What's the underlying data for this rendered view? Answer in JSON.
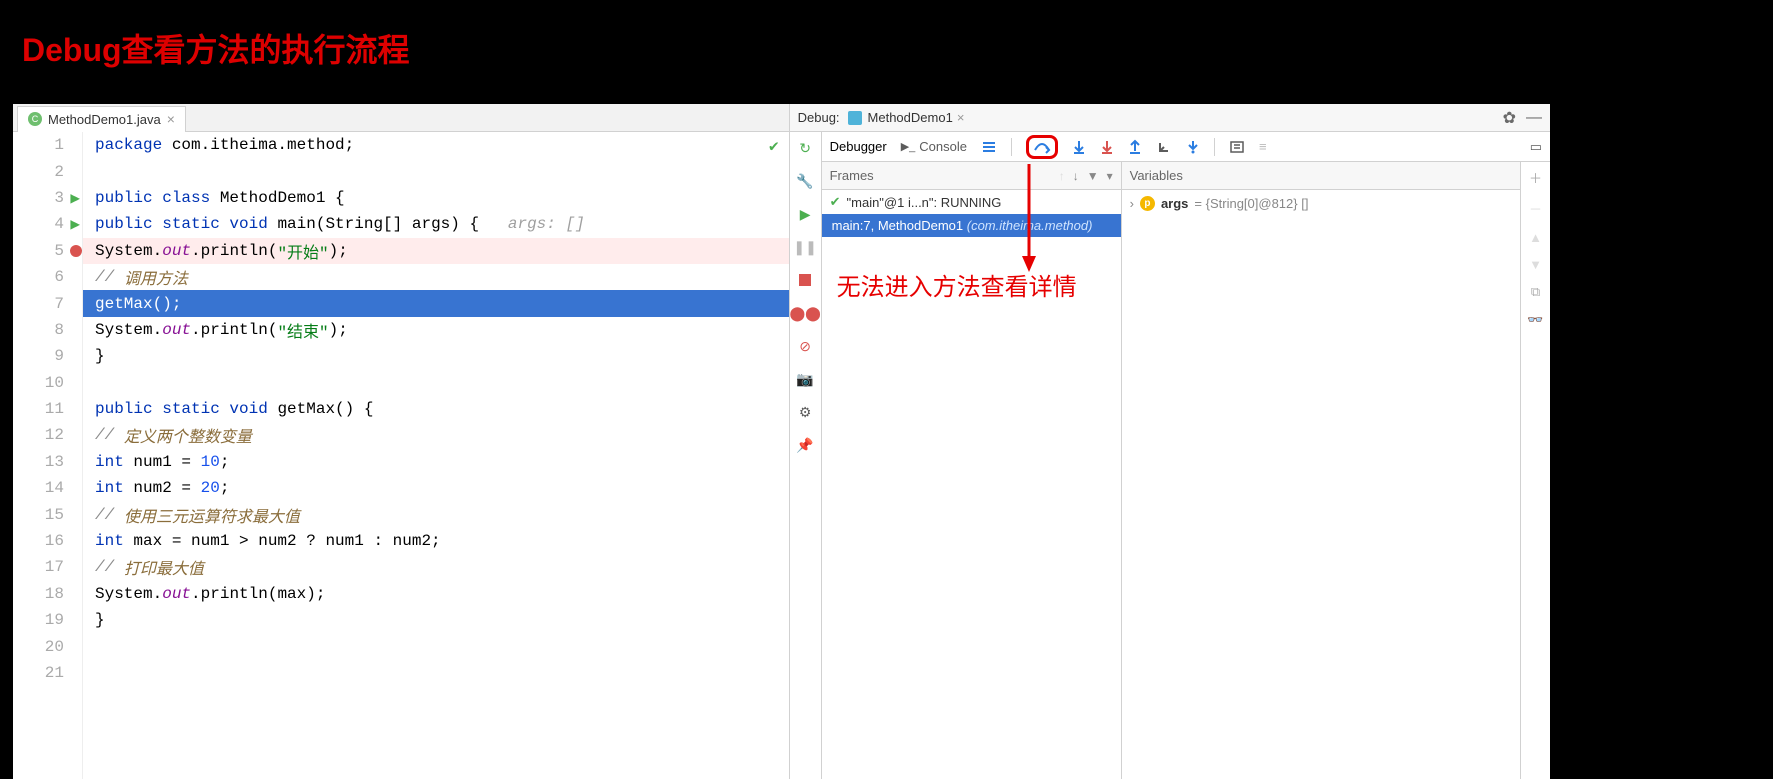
{
  "overlay_title": "Debug查看方法的执行流程",
  "editor": {
    "tab_filename": "MethodDemo1.java",
    "lines": [
      "package com.itheima.method;",
      "",
      "public class MethodDemo1 {",
      "    public static void main(String[] args) {   args: []",
      "        System.out.println(\"开始\");",
      "        // 调用方法",
      "        getMax();",
      "        System.out.println(\"结束\");",
      "    }",
      "",
      "    public static void getMax() {",
      "        // 定义两个整数变量",
      "        int num1 = 10;",
      "        int num2 = 20;",
      "        // 使用三元运算符求最大值",
      "        int max = num1 > num2 ? num1 : num2;",
      "        // 打印最大值",
      "        System.out.println(max);",
      "    }",
      "",
      ""
    ]
  },
  "debug": {
    "label": "Debug:",
    "config": "MethodDemo1",
    "tabs": {
      "debugger": "Debugger",
      "console": "Console"
    },
    "frames_label": "Frames",
    "variables_label": "Variables",
    "thread": "\"main\"@1 i...n\": RUNNING",
    "frame_main": "main:7, MethodDemo1 ",
    "frame_pkg": "(com.itheima.method)",
    "var_name": "args",
    "var_value": " = {String[0]@812} []",
    "annotation": "无法进入方法查看详情"
  }
}
